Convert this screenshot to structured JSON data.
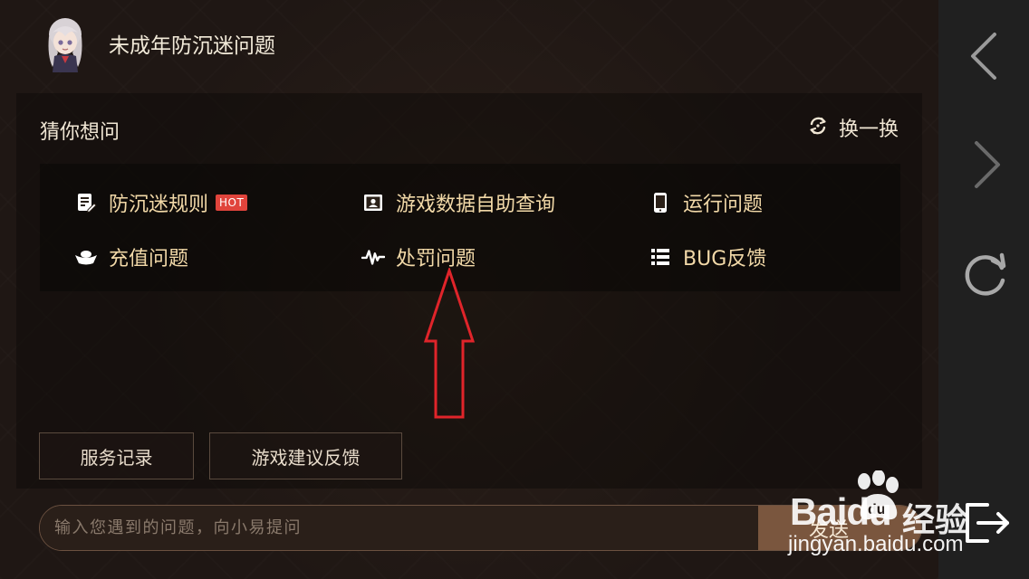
{
  "header": {
    "title": "未成年防沉迷问题"
  },
  "panel": {
    "title": "猜你想问",
    "refresh_label": "换一换",
    "questions": [
      {
        "label": "防沉迷规则",
        "badge": "HOT",
        "icon": "document-edit-icon"
      },
      {
        "label": "游戏数据自助查询",
        "icon": "id-card-icon"
      },
      {
        "label": "运行问题",
        "icon": "phone-icon"
      },
      {
        "label": "充值问题",
        "icon": "gold-ingot-icon"
      },
      {
        "label": "处罚问题",
        "icon": "pulse-icon"
      },
      {
        "label": "BUG反馈",
        "icon": "list-icon"
      }
    ]
  },
  "quick_buttons": {
    "service_records": "服务记录",
    "game_suggestions": "游戏建议反馈"
  },
  "input": {
    "placeholder": "输入您遇到的问题，向小易提问",
    "value": "",
    "send_label": "发送"
  },
  "right_rail": {
    "icons": [
      "chevron-left-icon",
      "chevron-right-icon",
      "reload-icon",
      "exit-icon"
    ]
  },
  "watermark": {
    "brand": "Baidu",
    "brand_suffix": "经验",
    "url": "jingyan.baidu.com"
  },
  "colors": {
    "accent_text": "#f2d9a8",
    "hot_badge": "#e0443c",
    "send_button": "#7a563e",
    "annotation_arrow": "#e0242a"
  }
}
